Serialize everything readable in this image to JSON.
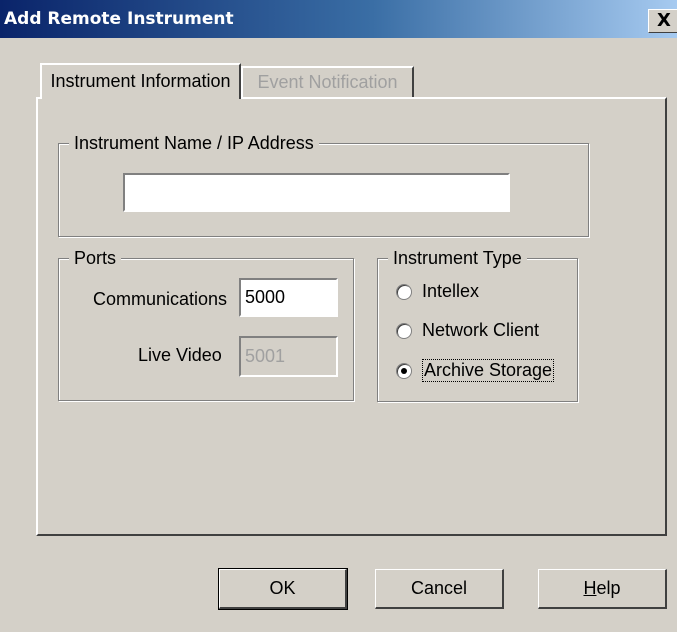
{
  "window": {
    "title": "Add Remote Instrument",
    "close_label": "X"
  },
  "tabs": [
    {
      "label": "Instrument Information",
      "active": true
    },
    {
      "label": "Event Notification",
      "active": false,
      "disabled": true
    }
  ],
  "instrument_name": {
    "group_label": "Instrument Name / IP Address",
    "value": ""
  },
  "ports": {
    "group_label": "Ports",
    "communications_label": "Communications",
    "communications_value": "5000",
    "live_video_label": "Live Video",
    "live_video_value": "5001"
  },
  "instrument_type": {
    "group_label": "Instrument Type",
    "options": [
      {
        "label": "Intellex",
        "checked": false
      },
      {
        "label": "Network Client",
        "checked": false
      },
      {
        "label": "Archive Storage",
        "checked": true
      }
    ]
  },
  "buttons": {
    "ok_label": "OK",
    "cancel_label": "Cancel",
    "help_mnemonic": "H",
    "help_rest": "elp"
  }
}
